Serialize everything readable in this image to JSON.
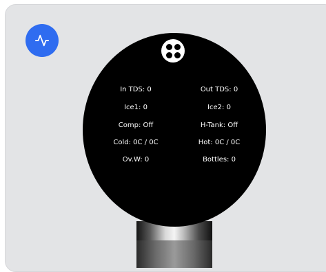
{
  "device": {
    "activity_icon": "activity-pulse-icon",
    "menu_icon": "four-dots-icon",
    "accent_color": "#2f6cf0"
  },
  "stats": {
    "in_tds": "In TDS: 0",
    "out_tds": "Out TDS: 0",
    "ice1": "Ice1: 0",
    "ice2": "Ice2: 0",
    "comp": "Comp: Off",
    "h_tank": "H-Tank: Off",
    "cold": "Cold: 0C / 0C",
    "hot": "Hot: 0C / 0C",
    "ovw": "Ov.W: 0",
    "bottles": "Bottles: 0"
  }
}
